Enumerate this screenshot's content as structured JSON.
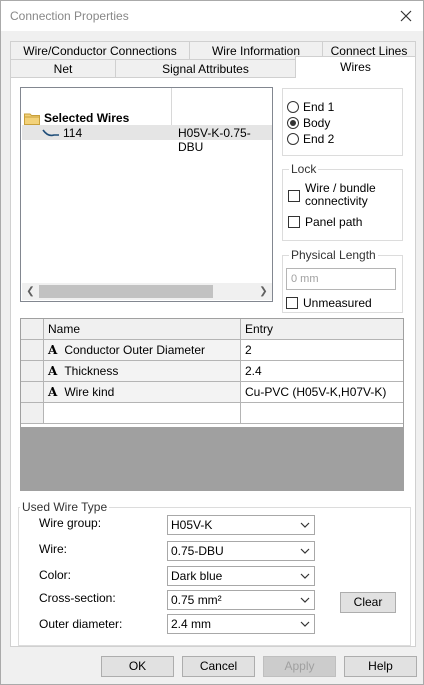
{
  "window": {
    "title": "Connection Properties"
  },
  "tabs": {
    "row1": [
      "Wire/Conductor Connections",
      "Wire Information",
      "Connect Lines"
    ],
    "row2": [
      "Net",
      "Signal Attributes",
      "Wires"
    ],
    "active": "Wires"
  },
  "tree": {
    "header": "Selected Wires",
    "rows": [
      {
        "number": "114",
        "type": "H05V-K-0.75-DBU"
      }
    ]
  },
  "position": {
    "options": [
      "End 1",
      "Body",
      "End 2"
    ],
    "selected": "Body"
  },
  "lock": {
    "title": "Lock",
    "wire_bundle": "Wire / bundle connectivity",
    "panel_path": "Panel path"
  },
  "physical_length": {
    "title": "Physical Length",
    "placeholder": "0 mm",
    "unmeasured": "Unmeasured"
  },
  "grid": {
    "headers": [
      "Name",
      "Entry"
    ],
    "rows": [
      {
        "icon": "A",
        "name": "Conductor Outer Diameter",
        "entry": "2"
      },
      {
        "icon": "A",
        "name": "Thickness",
        "entry": "2.4"
      },
      {
        "icon": "A",
        "name": "Wire kind",
        "entry": "Cu-PVC (H05V-K,H07V-K)"
      }
    ]
  },
  "used_wire_type": {
    "title": "Used Wire Type",
    "wire_group_label": "Wire group:",
    "wire_group_value": "H05V-K",
    "wire_label": "Wire:",
    "wire_value": "0.75-DBU",
    "color_label": "Color:",
    "color_value": "Dark blue",
    "cross_section_label": "Cross-section:",
    "cross_section_value": "0.75 mm²",
    "outer_diameter_label": "Outer diameter:",
    "outer_diameter_value": "2.4 mm",
    "clear_label": "Clear"
  },
  "buttons": {
    "ok": "OK",
    "cancel": "Cancel",
    "apply": "Apply",
    "help": "Help"
  },
  "colors": {
    "accent_folder": "#e8c24a",
    "wire_icon": "#1f4e79",
    "grid_empty": "#a0a0a0"
  }
}
